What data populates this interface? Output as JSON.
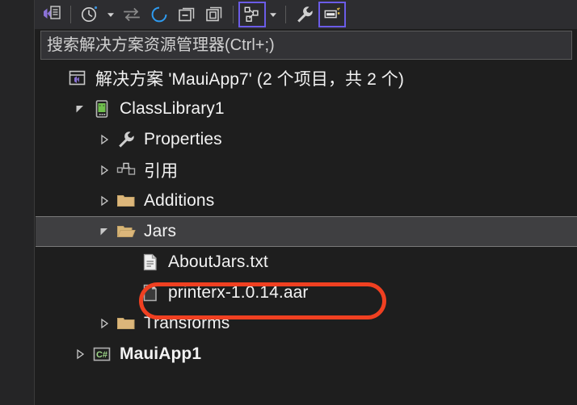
{
  "toolbar": {
    "buttons": [
      {
        "name": "code-map-icon",
        "title": "在代码视图中预览所选项",
        "toggled": false,
        "caret": false
      },
      {
        "name": "pending-changes-icon",
        "title": "挂起的更改筛选器",
        "toggled": false,
        "caret": true
      },
      {
        "name": "sync-with-active-document-icon",
        "title": "与活动文档同步",
        "toggled": false,
        "caret": false
      },
      {
        "name": "refresh-icon",
        "title": "刷新",
        "toggled": false,
        "caret": false
      },
      {
        "name": "collapse-all-icon",
        "title": "全部折叠",
        "toggled": false,
        "caret": false
      },
      {
        "name": "show-all-files-icon",
        "title": "显示所有文件",
        "toggled": false,
        "caret": false
      },
      {
        "name": "view-hierarchy-icon",
        "title": "视图",
        "toggled": true,
        "caret": true
      },
      {
        "name": "properties-wrench-icon",
        "title": "属性",
        "toggled": false,
        "caret": false
      },
      {
        "name": "preview-selected-items-icon",
        "title": "预览所选项",
        "toggled": true,
        "caret": false
      }
    ]
  },
  "search": {
    "placeholder": "搜索解决方案资源管理器(Ctrl+;)",
    "value": ""
  },
  "tree": {
    "nodes": [
      {
        "label": "解决方案 'MauiApp7' (2 个项目，共 2 个)",
        "icon": "solution-icon",
        "indent": 0,
        "twisty": "none",
        "selected": false,
        "bold": false
      },
      {
        "label": "ClassLibrary1",
        "icon": "android-project-icon",
        "indent": 1,
        "twisty": "expanded",
        "selected": false,
        "bold": false
      },
      {
        "label": "Properties",
        "icon": "wrench-icon",
        "indent": 2,
        "twisty": "collapsed",
        "selected": false,
        "bold": false
      },
      {
        "label": "引用",
        "icon": "references-icon",
        "indent": 2,
        "twisty": "collapsed",
        "selected": false,
        "bold": false
      },
      {
        "label": "Additions",
        "icon": "folder-closed-icon",
        "indent": 2,
        "twisty": "collapsed",
        "selected": false,
        "bold": false
      },
      {
        "label": "Jars",
        "icon": "folder-open-icon",
        "indent": 2,
        "twisty": "expanded",
        "selected": true,
        "bold": false
      },
      {
        "label": "AboutJars.txt",
        "icon": "text-file-icon",
        "indent": 3,
        "twisty": "none",
        "selected": false,
        "bold": false
      },
      {
        "label": "printerx-1.0.14.aar",
        "icon": "generic-file-icon",
        "indent": 3,
        "twisty": "none",
        "selected": false,
        "bold": false
      },
      {
        "label": "Transforms",
        "icon": "folder-closed-icon",
        "indent": 2,
        "twisty": "collapsed",
        "selected": false,
        "bold": false
      },
      {
        "label": "MauiApp1",
        "icon": "csharp-project-icon",
        "indent": 1,
        "twisty": "collapsed",
        "selected": false,
        "bold": true
      }
    ]
  },
  "annotation": {
    "target_label": "printerx-1.0.14.aar",
    "color": "#f04021",
    "shape": "rounded-rectangle"
  },
  "colors": {
    "background": "#1e1e1e",
    "toolbar_background": "#2d2d30",
    "gutter_background": "#252526",
    "selection_background": "#3f3f41",
    "selection_border": "#7a7a7a",
    "text": "#f2f2f2",
    "toggle_border": "#6b5ce7",
    "folder": "#dcb67a",
    "android_green": "#6fbf4c",
    "csharp_green": "#9fd88a",
    "refresh_blue": "#2e9bf0",
    "annotation_red": "#f04021"
  }
}
